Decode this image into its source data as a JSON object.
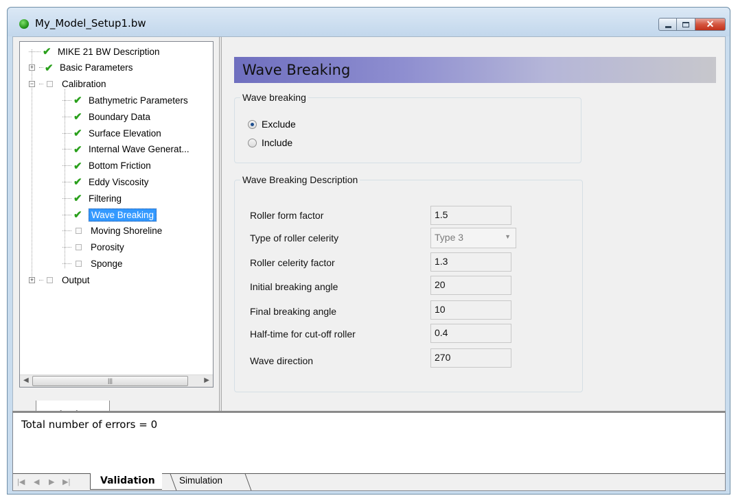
{
  "window": {
    "title": "My_Model_Setup1.bw"
  },
  "navigation": {
    "tab_label": "Navigation",
    "tree": [
      {
        "label": "MIKE 21 BW Description",
        "status": "checked",
        "level": 0,
        "expander": null
      },
      {
        "label": "Basic Parameters",
        "status": "checked",
        "level": 0,
        "expander": "+"
      },
      {
        "label": "Calibration",
        "status": "unchecked",
        "level": 0,
        "expander": "-"
      },
      {
        "label": "Bathymetric Parameters",
        "status": "checked",
        "level": 1,
        "expander": null
      },
      {
        "label": "Boundary Data",
        "status": "checked",
        "level": 1,
        "expander": null
      },
      {
        "label": "Surface Elevation",
        "status": "checked",
        "level": 1,
        "expander": null
      },
      {
        "label": "Internal Wave Generat...",
        "status": "checked",
        "level": 1,
        "expander": null
      },
      {
        "label": "Bottom Friction",
        "status": "checked",
        "level": 1,
        "expander": null
      },
      {
        "label": "Eddy Viscosity",
        "status": "checked",
        "level": 1,
        "expander": null
      },
      {
        "label": "Filtering",
        "status": "checked",
        "level": 1,
        "expander": null
      },
      {
        "label": "Wave Breaking",
        "status": "checked",
        "level": 1,
        "expander": null,
        "selected": true
      },
      {
        "label": "Moving Shoreline",
        "status": "unchecked",
        "level": 1,
        "expander": null
      },
      {
        "label": "Porosity",
        "status": "unchecked",
        "level": 1,
        "expander": null
      },
      {
        "label": "Sponge",
        "status": "unchecked",
        "level": 1,
        "expander": null
      },
      {
        "label": "Output",
        "status": "unchecked",
        "level": 0,
        "expander": "+"
      }
    ]
  },
  "main": {
    "header": "Wave Breaking",
    "wave_breaking_group": {
      "legend": "Wave breaking",
      "options": [
        {
          "label": "Exclude",
          "selected": true
        },
        {
          "label": "Include",
          "selected": false
        }
      ]
    },
    "description_group": {
      "legend": "Wave Breaking Description",
      "fields": [
        {
          "label": "Roller form factor",
          "value": "1.5",
          "type": "text"
        },
        {
          "label": "Type of roller celerity",
          "value": "Type 3",
          "type": "select"
        },
        {
          "label": "Roller celerity factor",
          "value": "1.3",
          "type": "text"
        },
        {
          "label": "Initial breaking angle",
          "value": "20",
          "type": "text"
        },
        {
          "label": "Final breaking angle",
          "value": "10",
          "type": "text"
        },
        {
          "label": "Half-time for cut-off roller",
          "value": "0.4",
          "type": "text"
        },
        {
          "label": "Wave direction",
          "value": "270",
          "type": "text"
        }
      ]
    }
  },
  "bottom": {
    "message": "Total number of errors = 0",
    "tabs": [
      {
        "label": "Validation",
        "active": true
      },
      {
        "label": "Simulation",
        "active": false
      }
    ]
  }
}
